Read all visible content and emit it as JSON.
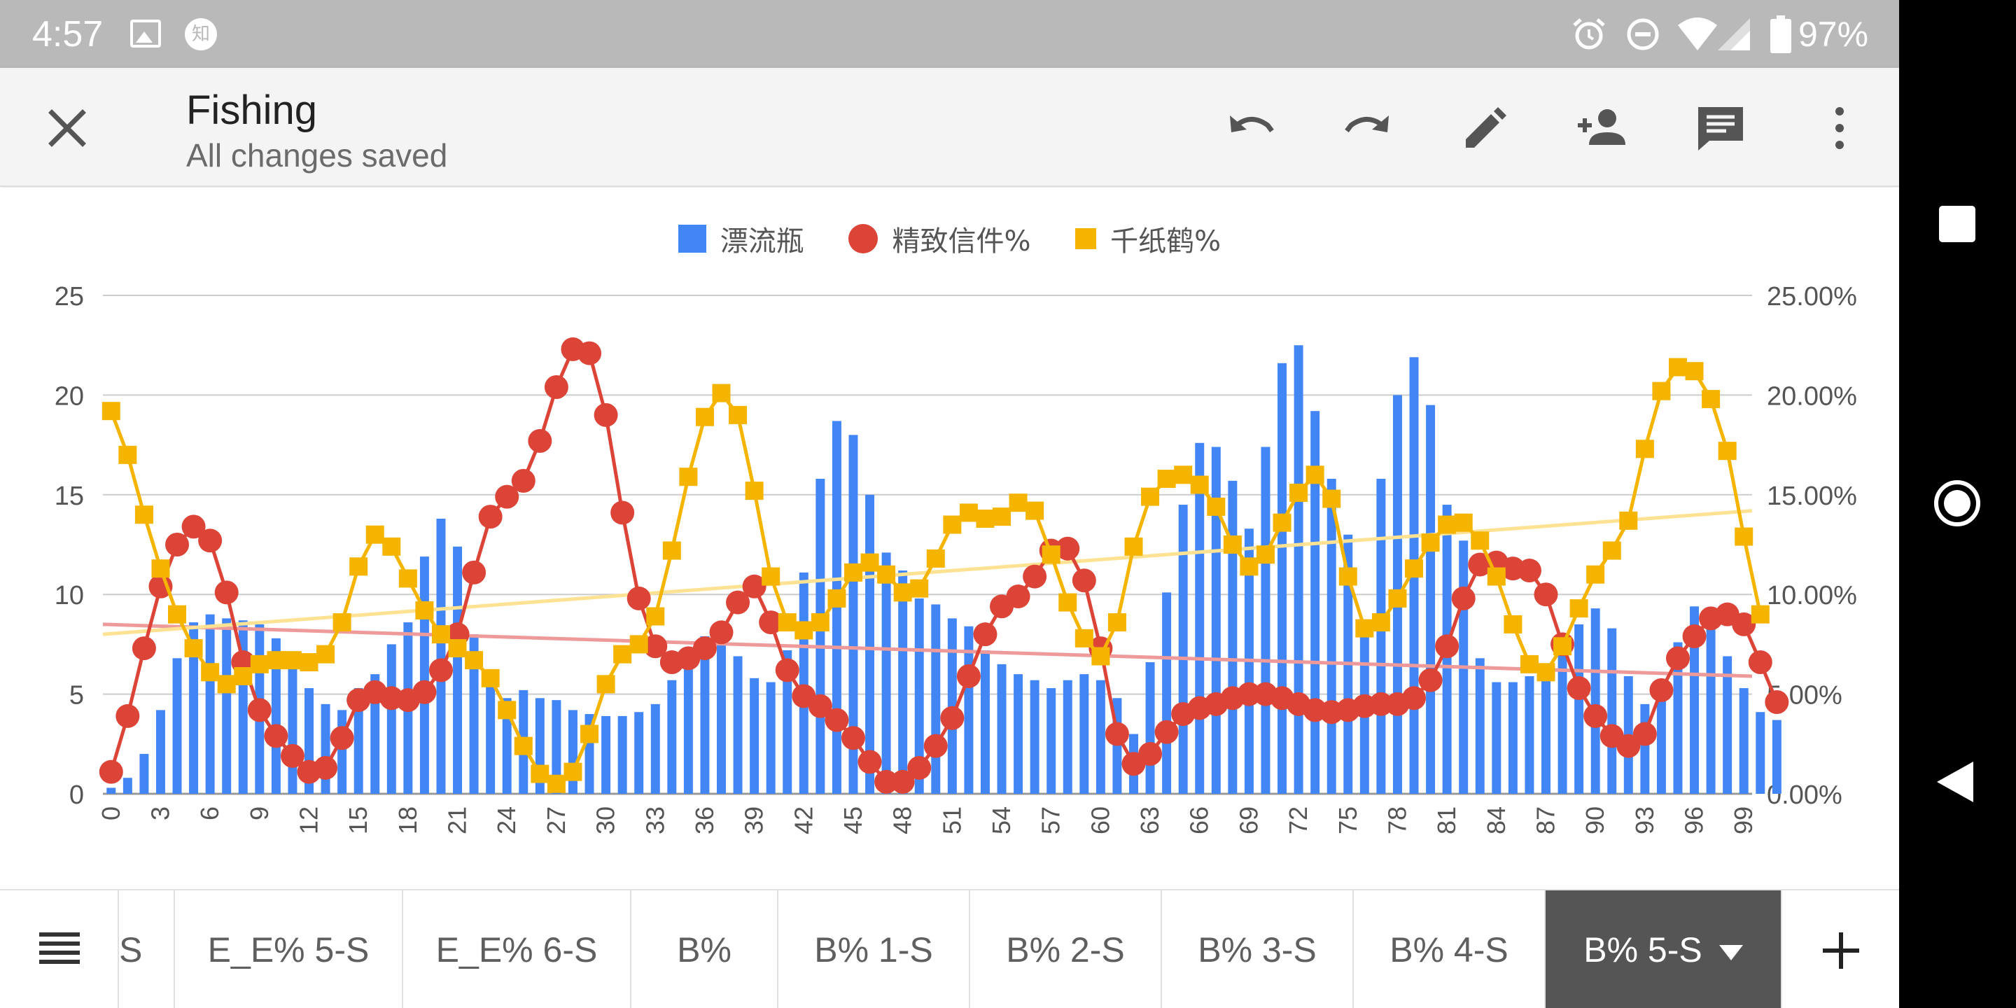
{
  "status_bar": {
    "time": "4:57",
    "notification_icons": [
      "image-icon",
      "zhihu-icon"
    ],
    "zhihu_glyph": "知",
    "system_icons": [
      "alarm-icon",
      "dnd-icon",
      "wifi-icon",
      "signal-icon",
      "battery-icon"
    ],
    "battery": "97%"
  },
  "toolbar": {
    "title": "Fishing",
    "subtitle": "All changes saved",
    "actions": [
      "undo-icon",
      "redo-icon",
      "edit-icon",
      "add-person-icon",
      "comment-icon",
      "more-icon"
    ]
  },
  "legend": {
    "items": [
      {
        "label": "漂流瓶",
        "color": "#4285f4",
        "shape": "square"
      },
      {
        "label": "精致信件%",
        "color": "#db4437",
        "shape": "circle"
      },
      {
        "label": "千纸鹤%",
        "color": "#f4b400",
        "shape": "square"
      }
    ]
  },
  "chart_data": {
    "type": "bar",
    "x": [
      0,
      1,
      2,
      3,
      4,
      5,
      6,
      7,
      8,
      9,
      10,
      11,
      12,
      13,
      14,
      15,
      16,
      17,
      18,
      19,
      20,
      21,
      22,
      23,
      24,
      25,
      26,
      27,
      28,
      29,
      30,
      31,
      32,
      33,
      34,
      35,
      36,
      37,
      38,
      39,
      40,
      41,
      42,
      43,
      44,
      45,
      46,
      47,
      48,
      49,
      50,
      51,
      52,
      53,
      54,
      55,
      56,
      57,
      58,
      59,
      60,
      61,
      62,
      63,
      64,
      65,
      66,
      67,
      68,
      69,
      70,
      71,
      72,
      73,
      74,
      75,
      76,
      77,
      78,
      79,
      80,
      81,
      82,
      83,
      84,
      85,
      86,
      87,
      88,
      89,
      90,
      91,
      92,
      93,
      94,
      95,
      96,
      97,
      98,
      99
    ],
    "x_tick_labels": [
      "0",
      "3",
      "6",
      "9",
      "12",
      "15",
      "18",
      "21",
      "24",
      "27",
      "30",
      "33",
      "36",
      "39",
      "42",
      "45",
      "48",
      "51",
      "54",
      "57",
      "60",
      "63",
      "66",
      "69",
      "72",
      "75",
      "78",
      "81",
      "84",
      "87",
      "90",
      "93",
      "96",
      "99"
    ],
    "left_axis": {
      "ylim": [
        0,
        25
      ],
      "ticks": [
        "0",
        "5",
        "10",
        "15",
        "20",
        "25"
      ]
    },
    "right_axis": {
      "ylim": [
        0,
        25
      ],
      "ticks": [
        "0.00%",
        "5.00%",
        "10.00%",
        "15.00%",
        "20.00%",
        "25.00%"
      ]
    },
    "grid": true,
    "legend_position": "top",
    "series": [
      {
        "name": "漂流瓶",
        "kind": "bar",
        "axis": "left",
        "color": "#4285f4",
        "values": [
          0.3,
          0.8,
          2,
          4.2,
          6.8,
          8.6,
          9,
          8.8,
          8.7,
          8.5,
          7.8,
          6.5,
          5.3,
          4.5,
          4.2,
          5.3,
          6,
          7.5,
          8.6,
          11.9,
          13.8,
          12.4,
          8,
          5.8,
          4.8,
          5.2,
          4.8,
          4.7,
          4.2,
          4,
          3.9,
          3.9,
          4.1,
          4.5,
          5.7,
          6.3,
          7.9,
          7.5,
          6.9,
          5.8,
          5.6,
          7.2,
          11.1,
          15.8,
          18.7,
          18,
          15,
          12.1,
          11.2,
          9.8,
          9.5,
          8.8,
          8.4,
          7.2,
          6.5,
          6,
          5.7,
          5.3,
          5.7,
          6,
          5.7,
          4.8,
          3,
          6.6,
          10.1,
          14.5,
          17.6,
          17.4,
          15.7,
          13.3,
          17.4,
          21.6,
          22.5,
          19.2,
          15.8,
          13,
          8.6,
          15.8,
          20,
          21.9,
          19.5,
          14.5,
          12.7,
          6.8,
          5.6,
          5.6,
          5.9,
          6.5,
          7.5,
          8.5,
          9.3,
          8.3,
          5.9,
          4.5,
          5.7,
          7.6,
          9.4,
          8.5,
          6.9,
          5.3,
          4.1,
          3.7
        ]
      },
      {
        "name": "精致信件%",
        "kind": "line",
        "axis": "right",
        "color": "#db4437",
        "marker": "circle",
        "values": [
          1.1,
          3.9,
          7.3,
          10.4,
          12.5,
          13.4,
          12.7,
          10.1,
          6.6,
          4.2,
          2.9,
          1.9,
          1.1,
          1.3,
          2.8,
          4.7,
          5.1,
          4.8,
          4.7,
          5.1,
          6.2,
          8,
          11.1,
          13.9,
          14.9,
          15.7,
          17.7,
          20.4,
          22.3,
          22.1,
          19,
          14.1,
          9.8,
          7.4,
          6.6,
          6.8,
          7.3,
          8.1,
          9.6,
          10.4,
          8.6,
          6.2,
          4.9,
          4.4,
          3.7,
          2.8,
          1.6,
          0.6,
          0.6,
          1.3,
          2.4,
          3.8,
          5.9,
          8,
          9.4,
          9.9,
          10.9,
          12.2,
          12.3,
          10.7,
          7.3,
          3,
          1.5,
          2,
          3.1,
          4,
          4.3,
          4.5,
          4.8,
          5,
          5,
          4.8,
          4.5,
          4.2,
          4.1,
          4.2,
          4.4,
          4.5,
          4.5,
          4.8,
          5.7,
          7.4,
          9.8,
          11.5,
          11.6,
          11.3,
          11.2,
          10,
          7.5,
          5.3,
          3.9,
          2.9,
          2.4,
          3,
          5.2,
          6.8,
          7.9,
          8.8,
          9,
          8.5,
          6.6,
          4.6
        ]
      },
      {
        "name": "千纸鹤%",
        "kind": "line",
        "axis": "right",
        "color": "#f4b400",
        "marker": "square",
        "values": [
          19.2,
          17,
          14,
          11.3,
          9,
          7.3,
          6.1,
          5.5,
          5.9,
          6.5,
          6.7,
          6.7,
          6.6,
          7,
          8.6,
          11.4,
          13,
          12.4,
          10.8,
          9.2,
          8,
          7.3,
          6.7,
          5.8,
          4.2,
          2.4,
          1,
          0.5,
          1.1,
          3,
          5.5,
          7,
          7.5,
          8.9,
          12.2,
          15.9,
          18.9,
          20.1,
          19,
          15.2,
          10.9,
          8.6,
          8.2,
          8.6,
          9.8,
          11.1,
          11.6,
          11,
          10.1,
          10.3,
          11.8,
          13.5,
          14.1,
          13.8,
          13.9,
          14.6,
          14.2,
          12,
          9.6,
          7.8,
          6.9,
          8.6,
          12.4,
          14.9,
          15.8,
          16,
          15.5,
          14.4,
          12.5,
          11.4,
          12,
          13.6,
          15.1,
          16,
          14.8,
          10.9,
          8.3,
          8.6,
          9.8,
          11.3,
          12.6,
          13.5,
          13.6,
          12.7,
          10.9,
          8.5,
          6.5,
          6.1,
          7.4,
          9.3,
          11,
          12.2,
          13.7,
          17.3,
          20.2,
          21.4,
          21.2,
          19.8,
          17.2,
          12.9,
          9
        ]
      },
      {
        "name": "",
        "kind": "trendline",
        "axis": "right",
        "color": "#ef9a9a",
        "from": [
          0,
          8.5
        ],
        "to": [
          100,
          5.9
        ]
      },
      {
        "name": "",
        "kind": "trendline",
        "axis": "right",
        "color": "#fde293",
        "from": [
          0,
          8.0
        ],
        "to": [
          100,
          14.2
        ]
      }
    ]
  },
  "sheet_tabs": {
    "items": [
      {
        "label": "S",
        "active": false
      },
      {
        "label": "E_E% 5-S",
        "active": false
      },
      {
        "label": "E_E% 6-S",
        "active": false
      },
      {
        "label": "B%",
        "active": false
      },
      {
        "label": "B% 1-S",
        "active": false
      },
      {
        "label": "B% 2-S",
        "active": false
      },
      {
        "label": "B% 3-S",
        "active": false
      },
      {
        "label": "B% 4-S",
        "active": false
      },
      {
        "label": "B% 5-S",
        "active": true
      }
    ]
  },
  "nav_bar": {
    "buttons": [
      "recents-icon",
      "home-icon",
      "back-icon"
    ]
  }
}
